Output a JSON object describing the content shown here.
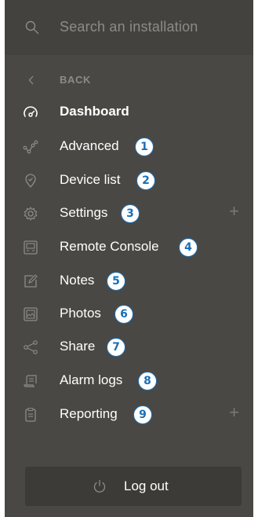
{
  "search": {
    "placeholder": "Search an installation"
  },
  "back": {
    "label": "BACK"
  },
  "menu": [
    {
      "label": "Dashboard",
      "icon": "gauge-icon",
      "active": true,
      "badge": "",
      "plus": ""
    },
    {
      "label": "Advanced",
      "icon": "graph-icon",
      "active": false,
      "badge": "1",
      "plus": ""
    },
    {
      "label": "Device list",
      "icon": "location-pin-icon",
      "active": false,
      "badge": "2",
      "plus": ""
    },
    {
      "label": "Settings",
      "icon": "gear-icon",
      "active": false,
      "badge": "3",
      "plus": "+"
    },
    {
      "label": "Remote Console",
      "icon": "console-icon",
      "active": false,
      "badge": "4",
      "plus": ""
    },
    {
      "label": "Notes",
      "icon": "edit-icon",
      "active": false,
      "badge": "5",
      "plus": ""
    },
    {
      "label": "Photos",
      "icon": "photo-icon",
      "active": false,
      "badge": "6",
      "plus": ""
    },
    {
      "label": "Share",
      "icon": "share-icon",
      "active": false,
      "badge": "7",
      "plus": ""
    },
    {
      "label": "Alarm logs",
      "icon": "alarm-log-icon",
      "active": false,
      "badge": "8",
      "plus": ""
    },
    {
      "label": "Reporting",
      "icon": "clipboard-icon",
      "active": false,
      "badge": "9",
      "plus": "+"
    }
  ],
  "logout": {
    "label": "Log out",
    "icon": "power-icon"
  },
  "colors": {
    "panel": "#4a4845",
    "search_bg": "#44423f",
    "muted": "#8d8b87",
    "badge": "#1a6fb5"
  }
}
